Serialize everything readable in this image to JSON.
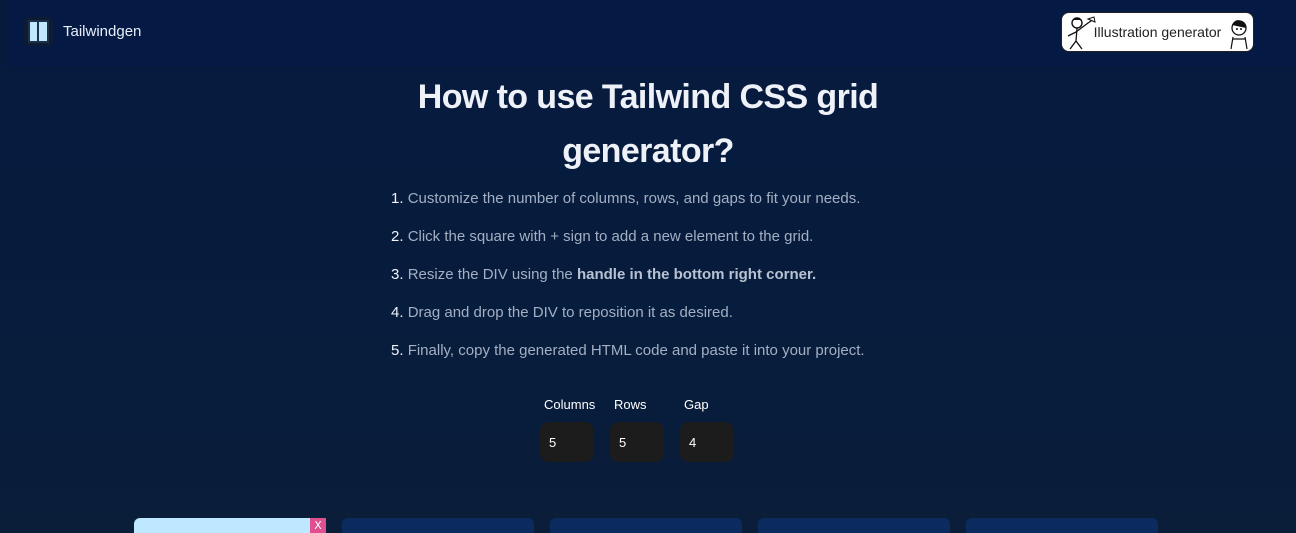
{
  "header": {
    "brand": "Tailwindgen",
    "illustration_button": "Illustration generator"
  },
  "main": {
    "title_line1": "How to use Tailwind CSS grid",
    "title_line2": "generator?",
    "steps": [
      {
        "num": "1.",
        "text": "Customize the number of columns, rows, and gaps to fit your needs.",
        "bold": ""
      },
      {
        "num": "2.",
        "text": "Click the square with + sign to add a new element to the grid.",
        "bold": ""
      },
      {
        "num": "3.",
        "text": "Resize the DIV using the ",
        "bold": "handle in the bottom right corner."
      },
      {
        "num": "4.",
        "text": "Drag and drop the DIV to reposition it as desired.",
        "bold": ""
      },
      {
        "num": "5.",
        "text": "Finally, copy the generated HTML code and paste it into your project.",
        "bold": ""
      }
    ]
  },
  "controls": {
    "columns": {
      "label": "Columns",
      "value": "5"
    },
    "rows": {
      "label": "Rows",
      "value": "5"
    },
    "gap": {
      "label": "Gap",
      "value": "4"
    }
  },
  "grid": {
    "remove_label": "X"
  },
  "colors": {
    "background": "#061a3e",
    "header": "#041a44",
    "active_cell": "#bde8ff",
    "remove_button": "#e0508e",
    "cell": "#0b2b5e"
  }
}
